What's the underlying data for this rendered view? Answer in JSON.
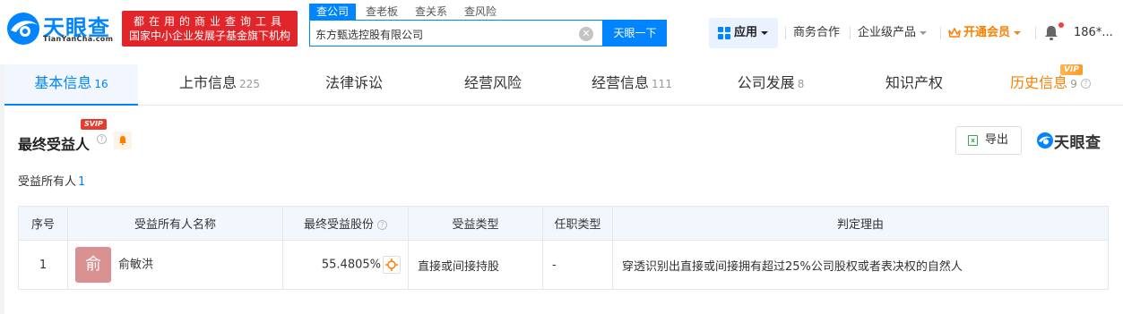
{
  "brand": {
    "name": "天眼查",
    "domain": "TianYanCha.com",
    "slogan_line1": "都在用的商业查询工具",
    "slogan_line2": "国家中小企业发展子基金旗下机构"
  },
  "search": {
    "tabs": [
      "查公司",
      "查老板",
      "查关系",
      "查风险"
    ],
    "active_tab": "查公司",
    "value": "东方甄选控股有限公司",
    "button_label": "天眼一下"
  },
  "nav": {
    "apps_label": "应用",
    "business": "商务合作",
    "enterprise": "企业级产品",
    "vip": "开通会员",
    "user": "186*..."
  },
  "tabs": [
    {
      "label": "基本信息",
      "count": "16"
    },
    {
      "label": "上市信息",
      "count": "225"
    },
    {
      "label": "法律诉讼",
      "count": ""
    },
    {
      "label": "经营风险",
      "count": ""
    },
    {
      "label": "经营信息",
      "count": "111"
    },
    {
      "label": "公司发展",
      "count": "8"
    },
    {
      "label": "知识产权",
      "count": ""
    },
    {
      "label": "历史信息",
      "count": "9"
    }
  ],
  "history_badge": "VIP",
  "section": {
    "title": "最终受益人",
    "badge": "SVIP",
    "export_label": "导出",
    "watermark": "天眼查",
    "owner_label": "受益所有人",
    "owner_count": "1"
  },
  "table": {
    "headers": [
      "序号",
      "受益所有人名称",
      "最终受益股份",
      "受益类型",
      "任职类型",
      "判定理由"
    ],
    "rows": [
      {
        "index": "1",
        "avatar_char": "俞",
        "name": "俞敏洪",
        "percent": "55.4805%",
        "type": "直接或间接持股",
        "position": "-",
        "reason": "穿透识别出直接或间接拥有超过25%公司股权或者表决权的自然人"
      }
    ]
  },
  "colors": {
    "primary": "#0084ff",
    "accent_orange": "#fe7e00",
    "slogan_red": "#e0262b"
  }
}
